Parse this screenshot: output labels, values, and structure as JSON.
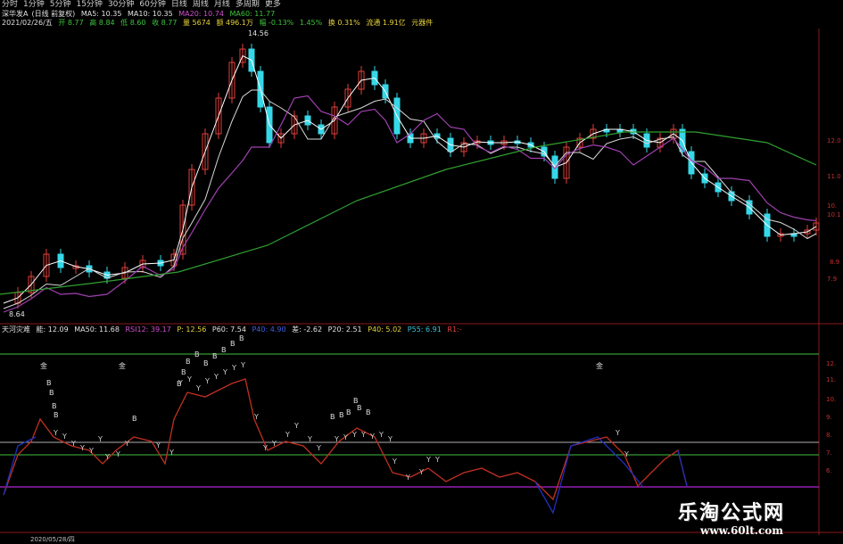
{
  "toolbar": {
    "tabs": [
      "分时",
      "1分钟",
      "5分钟",
      "15分钟",
      "30分钟",
      "60分钟",
      "日线",
      "周线",
      "月线",
      "多周期",
      "更多"
    ]
  },
  "stock_info": {
    "name": "深华发A",
    "mode": "(日线 前复权)",
    "ma5": "MA5: 10.35",
    "ma10": "MA10: 10.35",
    "ma20": "MA20: 10.74",
    "ma60": "MA60: 11.77"
  },
  "day_info": {
    "date": "2021/02/26/五",
    "open": "开 8.77",
    "high": "高 8.84",
    "low": "低 8.60",
    "close": "收 8.77",
    "volume": "量 5674",
    "amount": "额 496.1万",
    "change": "幅 -0.13%",
    "amplitude": "1.45%",
    "turnover": "换 0.31%",
    "float_cap": "流通 1.91亿",
    "industry": "元器件"
  },
  "price_labels": {
    "peak": "14.56",
    "low": "8.64",
    "axis_right": [
      "12.0",
      "11.0",
      "10.",
      "10.1",
      "8.9",
      "7.9"
    ]
  },
  "indicator_info": {
    "name": "天河灾难",
    "v1": "能: 12.09",
    "ma50": "MA50: 11.68",
    "rsi": "RSI12: 39.17",
    "p": "P: 12.56",
    "p60": "P60: 7.54",
    "p40a": "P40: 4.90",
    "diff": "差: -2.62",
    "p20": "P20: 2.51",
    "p40": "P40: 5.02",
    "p55": "P55: 6.91",
    "r": "R1:-"
  },
  "indicator_axis": [
    "12.",
    "11.",
    "10.",
    "9.",
    "8.",
    "7.",
    "6."
  ],
  "markers": {
    "gold": "金",
    "b": "B",
    "y": "Y"
  },
  "watermark": {
    "line1": "乐淘公式网",
    "line2": "www.60lt.com"
  },
  "date_bar": {
    "start": "2020/05/28/四"
  },
  "colors": {
    "up": "#e0403a",
    "down": "#36d8e8",
    "ma5": "#ffffff",
    "ma10": "#d8d8d8",
    "ma20": "#a040b0",
    "ma60": "#30a030",
    "grid": "#8a1a1a",
    "ind_line": "#c03020",
    "ind_blue": "#2030c0",
    "h_green": "#40c040",
    "h_gray": "#b0b0b0",
    "h_purple": "#9020b0"
  }
}
